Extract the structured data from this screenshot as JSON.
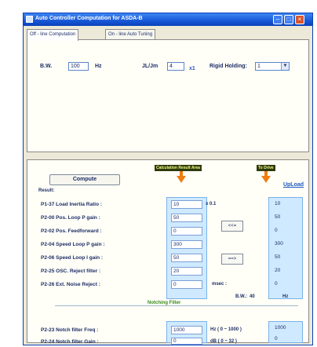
{
  "window": {
    "title": "Auto Controller Computation for ASDA-B",
    "controls": {
      "minimize": "–",
      "maximize": "□",
      "close": "×"
    }
  },
  "tabs": [
    {
      "label": "Off - line Computation"
    },
    {
      "label": "On - line Auto Tuning"
    }
  ],
  "offline": {
    "bw_label": "B.W.",
    "bw_value": "100",
    "bw_unit": "Hz",
    "jl_label": "JL/Jm",
    "jl_value": "4",
    "jl_unit": "x1",
    "rigid_label": "Rigid Holding:",
    "rigid_value": "1"
  },
  "actions": {
    "compute_label": "Compute",
    "upload_label": "UpLoad",
    "calc_area_label": "Calculation Result Area",
    "to_drive_label": "To Drive",
    "result_label": "Result:",
    "copy_left_label": "<<=",
    "copy_right_label": "==>"
  },
  "params": [
    {
      "label": "P1-37 Load Inertia Ratio :",
      "value": "10",
      "unit": "x 0.1",
      "drive": "10"
    },
    {
      "label": "P2-00 Pos. Loop P gain :",
      "value": "50",
      "unit": "",
      "drive": "50"
    },
    {
      "label": "P2-02 Pos. Feedforward :",
      "value": "0",
      "unit": "",
      "drive": "0"
    },
    {
      "label": "P2-04 Speed Loop P gain :",
      "value": "300",
      "unit": "",
      "drive": "300"
    },
    {
      "label": "P2-06 Speed Loop I gain :",
      "value": "50",
      "unit": "",
      "drive": "50"
    },
    {
      "label": "P2-25 OSC. Reject filter :",
      "value": "20",
      "unit": "",
      "drive": "20"
    },
    {
      "label": "P2-26 Ext. Noise Reject :",
      "value": "0",
      "unit": "msec :",
      "drive": "0"
    }
  ],
  "notch": {
    "title": "Notching Filter",
    "bw_label": "B.W.:",
    "bw_value": "40",
    "bw_unit": "Hz",
    "freq_label": "P2-23 Notch filter Freq :",
    "freq_value": "1000",
    "freq_unit": "Hz ( 0 ~ 1000 )",
    "freq_drive": "1000",
    "gain_label": "P2-24 Notch filter Gain :",
    "gain_value": "0",
    "gain_unit": "dB ( 0 ~ 32 )",
    "gain_drive": "0"
  },
  "icons": [
    "app-icon",
    "arrow-down-icon",
    "dropdown-arrow-icon"
  ]
}
